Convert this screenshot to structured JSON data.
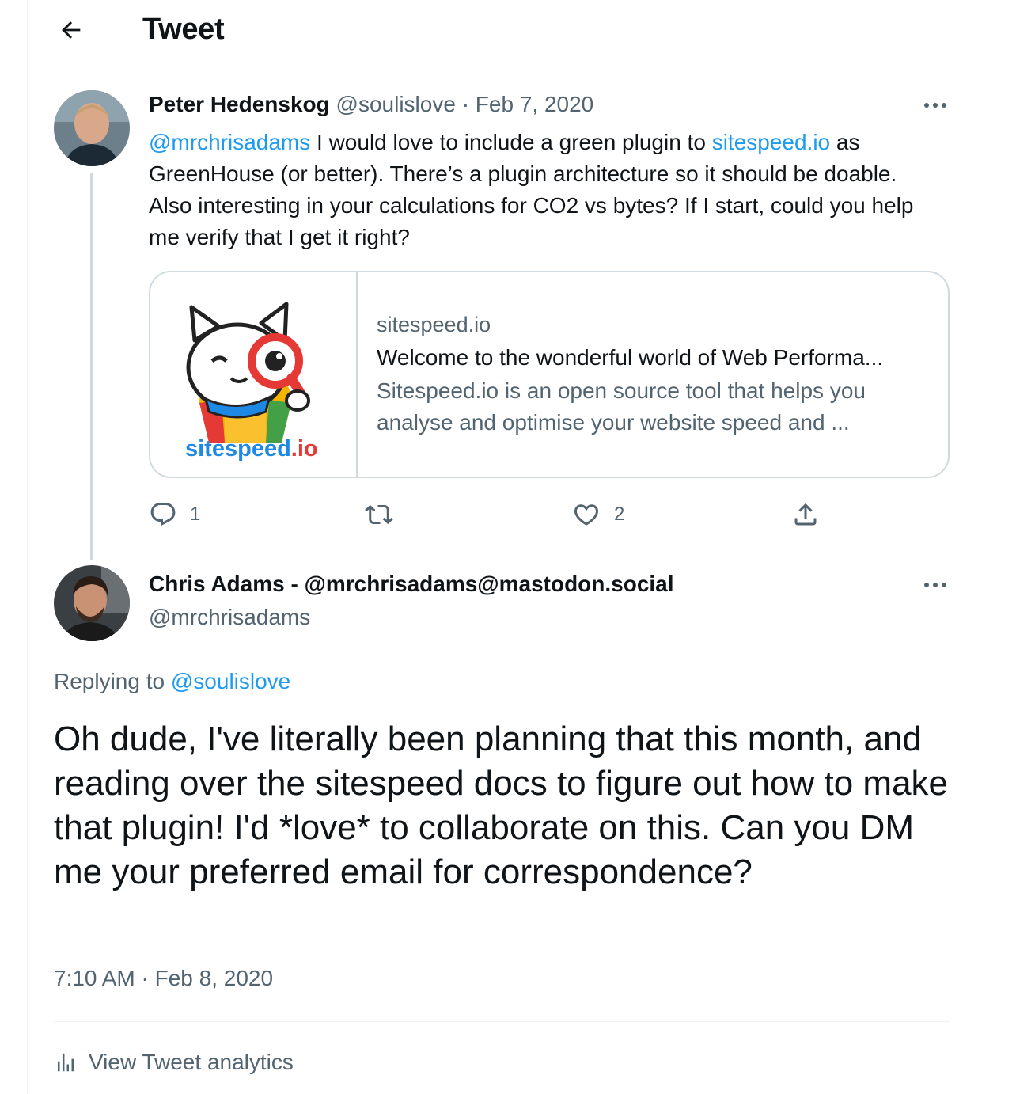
{
  "header": {
    "title": "Tweet"
  },
  "tweet1": {
    "author_name": "Peter Hedenskog",
    "handle": "@soulislove",
    "separator": "·",
    "date": "Feb 7, 2020",
    "text": {
      "mention": "@mrchrisadams",
      "part1": " I would love to include a green plugin to ",
      "link": "sitespeed.io",
      "part2": " as GreenHouse (or better). There’s a plugin architecture so it should be doable. Also interesting in your calculations for CO2 vs bytes? If I start, could you help me verify that I get it right?"
    },
    "card": {
      "logo_text_1": "sitespeed",
      "logo_text_2": ".io",
      "domain": "sitespeed.io",
      "title": "Welcome to the wonderful world of Web Performa...",
      "description": "Sitespeed.io is an open source tool that helps you analyse and optimise your website speed and ..."
    },
    "actions": {
      "reply_count": "1",
      "like_count": "2"
    }
  },
  "tweet2": {
    "author_name": "Chris Adams - @mrchrisadams@mastodon.social",
    "handle": "@mrchrisadams",
    "replying_prefix": "Replying to ",
    "replying_to": "@soulislove",
    "text": "Oh dude, I've literally been planning that this month, and reading over the sitespeed docs to figure out how to make that plugin! I'd *love* to collaborate on this. Can you DM me your preferred email for correspondence?",
    "timestamp": "7:10 AM · Feb 8, 2020",
    "analytics_label": "View Tweet analytics"
  },
  "colors": {
    "link": "#1d9bf0",
    "muted": "#536471",
    "text": "#0f1419",
    "border": "#cfd9de"
  },
  "icons": [
    "back-arrow-icon",
    "more-icon",
    "reply-icon",
    "retweet-icon",
    "like-icon",
    "share-icon",
    "analytics-icon"
  ]
}
